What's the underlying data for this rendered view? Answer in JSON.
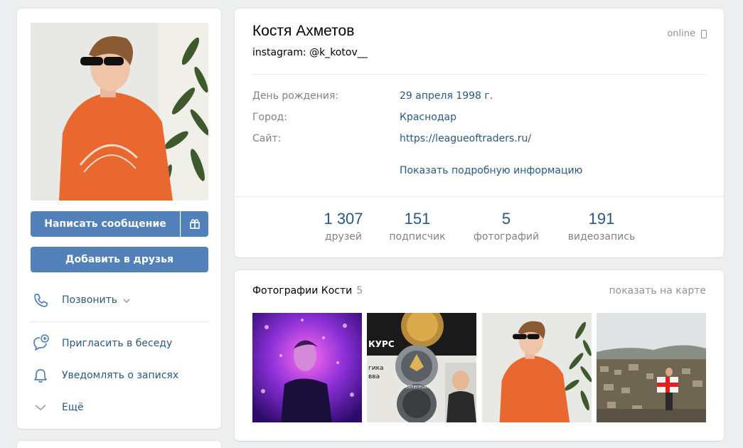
{
  "left": {
    "message_button": "Написать сообщение",
    "gift_icon": "gift-icon",
    "add_friend_button": "Добавить в друзья",
    "call": "Позвонить",
    "invite": "Пригласить в беседу",
    "notify": "Уведомлять о записях",
    "more": "Ещё"
  },
  "profile": {
    "name": "Костя Ахметов",
    "status": "instagram: @k_kotov__",
    "online": "online",
    "info": [
      {
        "label": "День рождения:",
        "value": "29 апреля 1998 г."
      },
      {
        "label": "Город:",
        "value": "Краснодар"
      },
      {
        "label": "Сайт:",
        "value": "https://leagueoftraders.ru/"
      }
    ],
    "show_more": "Показать подробную информацию",
    "counters": [
      {
        "num": "1 307",
        "label": "друзей"
      },
      {
        "num": "151",
        "label": "подписчик"
      },
      {
        "num": "5",
        "label": "фотографий"
      },
      {
        "num": "191",
        "label": "видеозапись"
      }
    ]
  },
  "photos": {
    "title": "Фотографии Кости",
    "count": "5",
    "map_link": "показать на карте",
    "thumb2_text_1": "КУРС",
    "thumb2_text_2": "гика",
    "thumb2_text_3": "вва",
    "thumb2_text_4": "ethereum"
  },
  "colors": {
    "accent": "#5181b8",
    "link": "#2a5885",
    "background": "#edeef0",
    "muted": "#828282"
  }
}
